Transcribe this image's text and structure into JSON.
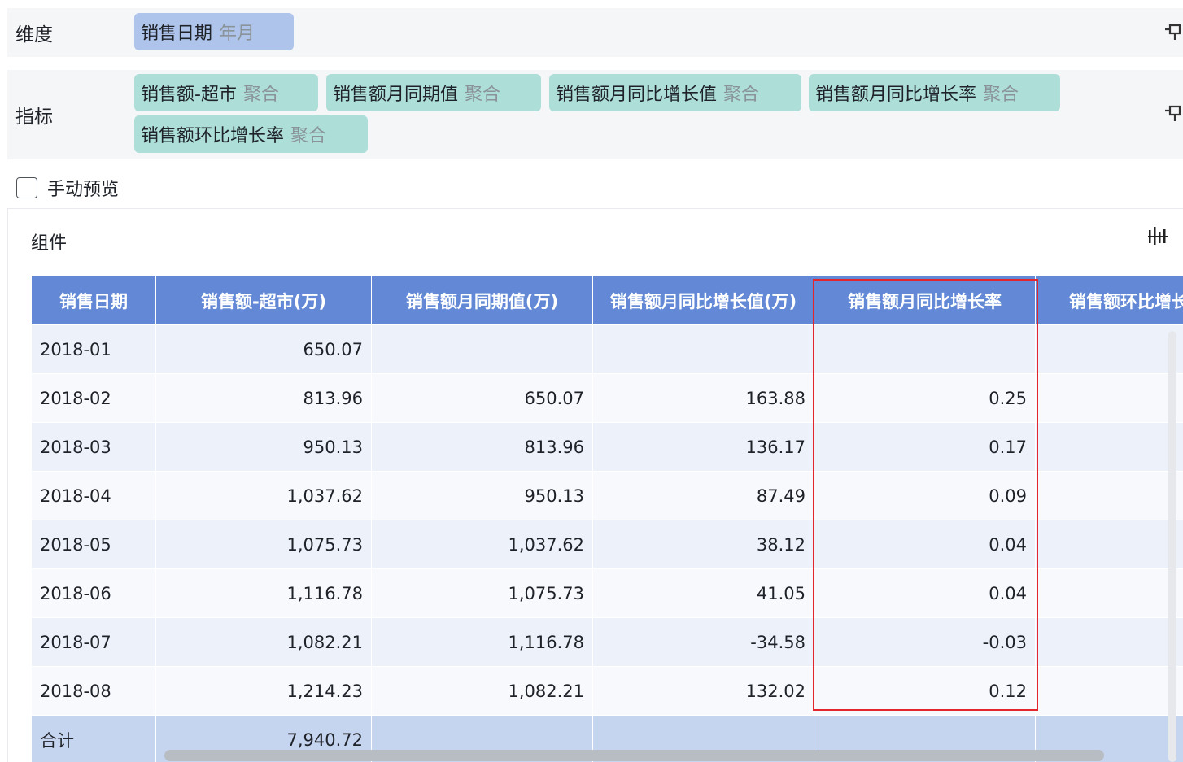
{
  "dimension": {
    "label": "维度",
    "fields": [
      {
        "name": "销售日期",
        "tag": "年月"
      }
    ]
  },
  "measure": {
    "label": "指标",
    "fields": [
      {
        "name": "销售额-超市",
        "tag": "聚合"
      },
      {
        "name": "销售额月同期值",
        "tag": "聚合"
      },
      {
        "name": "销售额月同比增长值",
        "tag": "聚合"
      },
      {
        "name": "销售额月同比增长率",
        "tag": "聚合"
      },
      {
        "name": "销售额环比增长率",
        "tag": "聚合"
      }
    ]
  },
  "manual_preview": {
    "label": "手动预览",
    "checked": false
  },
  "component": {
    "title": "组件"
  },
  "table": {
    "headers": [
      "销售日期",
      "销售额-超市(万)",
      "销售额月同期值(万)",
      "销售额月同比增长值(万)",
      "销售额月同比增长率",
      "销售额环比增长率"
    ],
    "rows": [
      [
        "2018-01",
        "650.07",
        "",
        "",
        "",
        ""
      ],
      [
        "2018-02",
        "813.96",
        "650.07",
        "163.88",
        "0.25",
        ""
      ],
      [
        "2018-03",
        "950.13",
        "813.96",
        "136.17",
        "0.17",
        ""
      ],
      [
        "2018-04",
        "1,037.62",
        "950.13",
        "87.49",
        "0.09",
        ""
      ],
      [
        "2018-05",
        "1,075.73",
        "1,037.62",
        "38.12",
        "0.04",
        ""
      ],
      [
        "2018-06",
        "1,116.78",
        "1,075.73",
        "41.05",
        "0.04",
        ""
      ],
      [
        "2018-07",
        "1,082.21",
        "1,116.78",
        "-34.58",
        "-0.03",
        ""
      ],
      [
        "2018-08",
        "1,214.23",
        "1,082.21",
        "132.02",
        "0.12",
        ""
      ]
    ],
    "total": [
      "合计",
      "7,940.72",
      "",
      "",
      "",
      ""
    ]
  },
  "colors": {
    "header_bg": "#6389d6",
    "dimension_pill": "#aec4ea",
    "measure_pill": "#addfd8",
    "highlight_border": "#e3262b",
    "total_row_bg": "#c6d5ef"
  },
  "icons": [
    "pin-icon",
    "chart-settings-icon"
  ]
}
